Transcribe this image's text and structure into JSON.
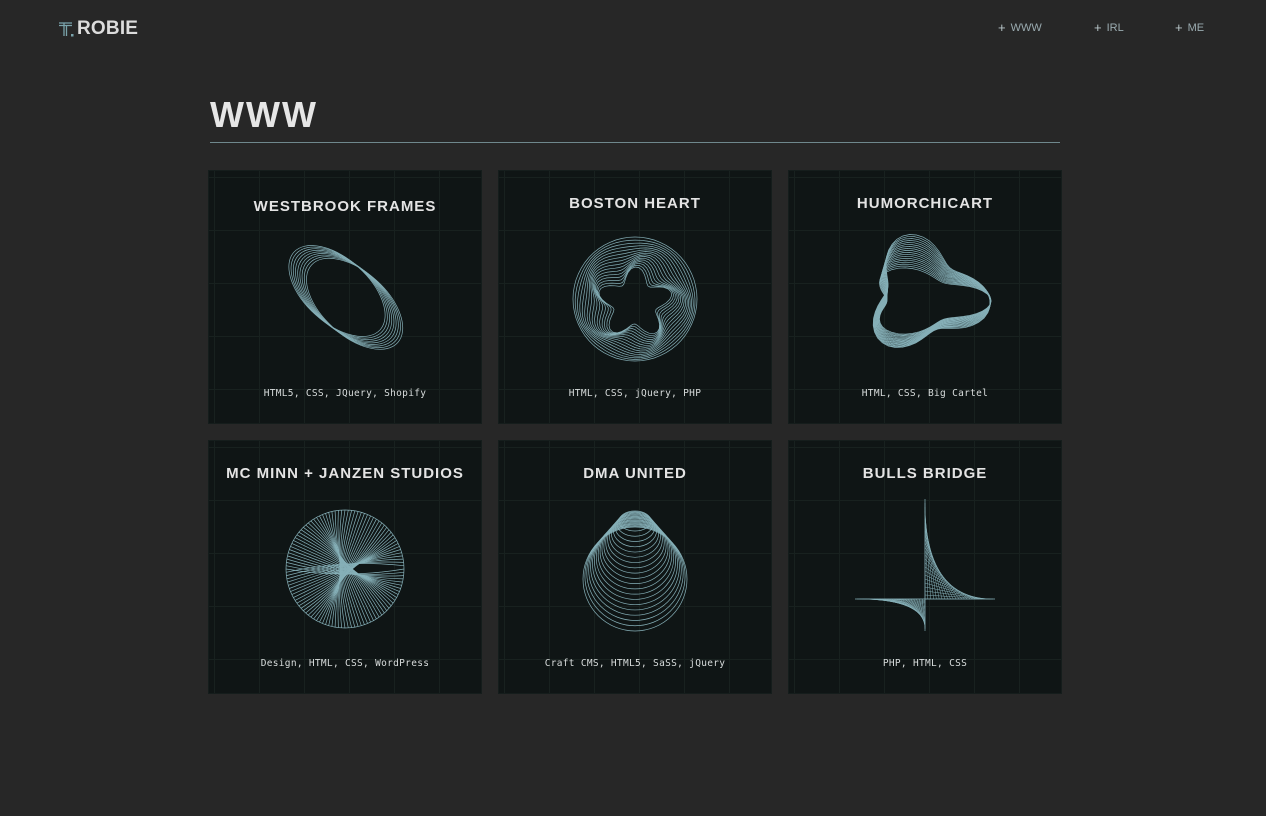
{
  "brand": {
    "mark": "T.",
    "name": "ROBIE",
    "accent_color": "#7aa3ab"
  },
  "nav": [
    {
      "label": "WWW",
      "icon": "plus-icon"
    },
    {
      "label": "IRL",
      "icon": "plus-icon"
    },
    {
      "label": "ME",
      "icon": "plus-icon"
    }
  ],
  "page": {
    "title": "WWW"
  },
  "projects": [
    {
      "title": "WESTBROOK FRAMES",
      "tags": "HTML5, CSS, JQuery, Shopify",
      "art": "ring-band"
    },
    {
      "title": "BOSTON HEART",
      "tags": "HTML, CSS, jQuery, PHP",
      "art": "wavy-sphere"
    },
    {
      "title": "HUMORCHICART",
      "tags": "HTML, CSS, Big Cartel",
      "art": "twisted-triangle"
    },
    {
      "title": "MC MINN + JANZEN STUDIOS",
      "tags": "Design,  HTML,  CSS,  WordPress",
      "art": "radial-disc"
    },
    {
      "title": "DMA UNITED",
      "tags": "Craft CMS,  HTML5,  SaSS,  jQuery",
      "art": "cone-rings"
    },
    {
      "title": "BULLS BRIDGE",
      "tags": "PHP,  HTML,  CSS",
      "art": "string-curve"
    }
  ],
  "colors": {
    "background": "#272727",
    "card": "#0f1515",
    "line_art": "#86b0b8",
    "rule": "#6f888d"
  }
}
